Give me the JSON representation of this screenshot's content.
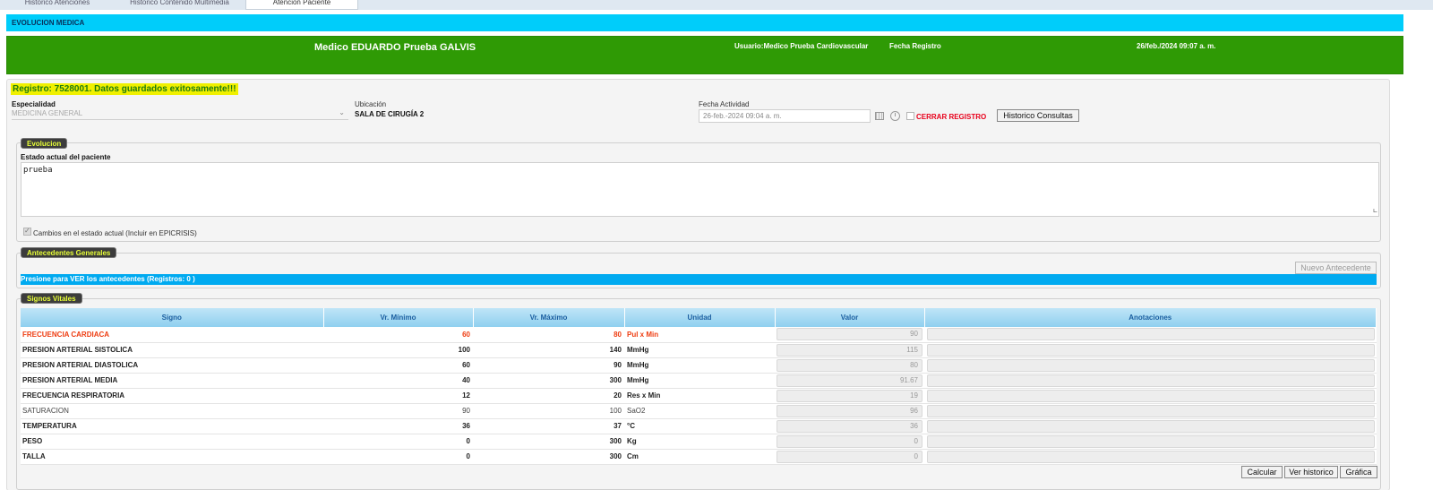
{
  "tabs": [
    {
      "label": "Historico Atenciones"
    },
    {
      "label": "Historico Contenido Multimedia"
    },
    {
      "label": "Atencion Paciente"
    }
  ],
  "title": "EVOLUCION MEDICA",
  "header": {
    "doctor": "Medico EDUARDO Prueba GALVIS",
    "user": "Usuario:Medico Prueba Cardiovascular",
    "fecha_registro_label": "Fecha Registro",
    "fecha_registro_value": "26/feb./2024 09:07 a. m."
  },
  "message": "Registro: 7528001. Datos guardados exitosamente!!!",
  "form": {
    "especialidad_label": "Especialidad",
    "especialidad_value": "MEDICINA GENERAL",
    "ubicacion_label": "Ubicación",
    "ubicacion_value": "SALA DE CIRUGÍA 2",
    "fecha_actividad_label": "Fecha Actividad",
    "fecha_actividad_value": "26-feb.-2024 09:04 a. m.",
    "cerrar_label": "CERRAR REGISTRO",
    "historico_btn": "Historico Consultas"
  },
  "evolucion": {
    "legend": "Evolucion",
    "estado_label": "Estado actual del paciente",
    "estado_value": "prueba",
    "cambios_label": "Cambios en el estado actual (Incluir en EPICRISIS)"
  },
  "antecedentes": {
    "legend": "Antecedentes Generales",
    "nuevo_btn": "Nuevo Antecedente",
    "bar_text": "Presione para VER los antecedentes (Registros: 0 )"
  },
  "signos": {
    "legend": "Signos Vitales",
    "columns": [
      "Signo",
      "Vr. Mínimo",
      "Vr. Máximo",
      "Unidad",
      "Valor",
      "Anotaciones"
    ],
    "rows": [
      {
        "signo": "FRECUENCIA CARDIACA",
        "min": "60",
        "max": "80",
        "unidad": "Pul x Min",
        "valor": "90"
      },
      {
        "signo": "PRESION ARTERIAL SISTOLICA",
        "min": "100",
        "max": "140",
        "unidad": "MmHg",
        "valor": "115"
      },
      {
        "signo": "PRESION ARTERIAL DIASTOLICA",
        "min": "60",
        "max": "90",
        "unidad": "MmHg",
        "valor": "80"
      },
      {
        "signo": "PRESION ARTERIAL MEDIA",
        "min": "40",
        "max": "300",
        "unidad": "MmHg",
        "valor": "91.67"
      },
      {
        "signo": "FRECUENCIA RESPIRATORIA",
        "min": "12",
        "max": "20",
        "unidad": "Res x Min",
        "valor": "19"
      },
      {
        "signo": "SATURACION",
        "min": "90",
        "max": "100",
        "unidad": "SaO2",
        "valor": "96"
      },
      {
        "signo": "TEMPERATURA",
        "min": "36",
        "max": "37",
        "unidad": "°C",
        "valor": "36"
      },
      {
        "signo": "PESO",
        "min": "0",
        "max": "300",
        "unidad": "Kg",
        "valor": "0"
      },
      {
        "signo": "TALLA",
        "min": "0",
        "max": "300",
        "unidad": "Cm",
        "valor": "0"
      }
    ],
    "buttons": {
      "calcular": "Calcular",
      "ver_historico": "Ver historico",
      "grafica": "Gráfica"
    }
  },
  "colors": {
    "title_bar": "#00cdfa",
    "header_green": "#2f9a05",
    "alert": "#ee3c10",
    "legend_bg": "#3c3c3c",
    "legend_text": "#e8ff38"
  }
}
